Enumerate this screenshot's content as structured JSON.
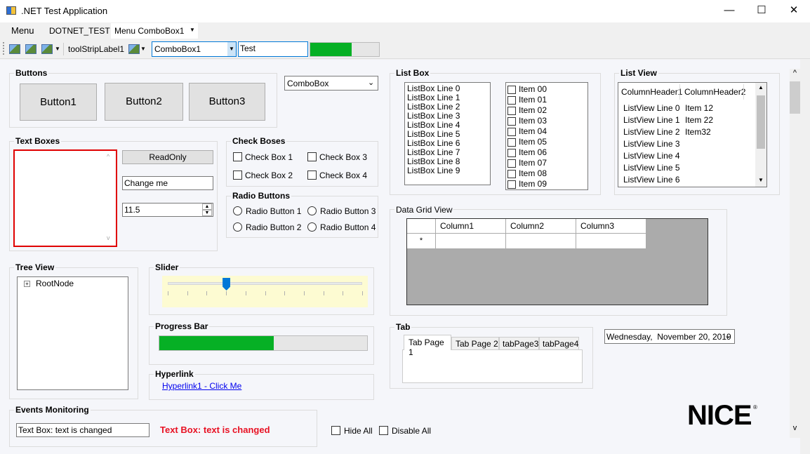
{
  "window": {
    "title": ".NET Test Application",
    "minimize": "—",
    "maximize": "☐",
    "close": "✕"
  },
  "menu": {
    "items": [
      "Menu",
      "DOTNET_TEST",
      "Menu ComboBox1"
    ]
  },
  "toolbar": {
    "label": "toolStripLabel1",
    "combo": "ComboBox1",
    "text": "Test",
    "progress_pct": 60
  },
  "buttons": {
    "title": "Buttons",
    "b1": "Button1",
    "b2": "Button2",
    "b3": "Button3"
  },
  "combo": {
    "value": "ComboBox"
  },
  "textboxes": {
    "title": "Text Boxes",
    "readonly": "ReadOnly",
    "changeme": "Change me",
    "numeric": "11.5"
  },
  "checkboxes": {
    "title": "Check Boses",
    "c1": "Check Box 1",
    "c2": "Check Box 2",
    "c3": "Check Box 3",
    "c4": "Check Box 4"
  },
  "radios": {
    "title": "Radio Buttons",
    "r1": "Radio Button 1",
    "r2": "Radio Button 2",
    "r3": "Radio Button 3",
    "r4": "Radio Button 4"
  },
  "listbox": {
    "title": "List Box",
    "lines": [
      "ListBox Line 0",
      "ListBox Line 1",
      "ListBox Line 2",
      "ListBox Line 3",
      "ListBox Line 4",
      "ListBox Line 5",
      "ListBox Line 6",
      "ListBox Line 7",
      "ListBox Line 8",
      "ListBox Line 9"
    ],
    "items": [
      "Item 00",
      "Item 01",
      "Item 02",
      "Item 03",
      "Item 04",
      "Item 05",
      "Item 06",
      "Item 07",
      "Item 08",
      "Item 09"
    ]
  },
  "listview": {
    "title": "List View",
    "headers": [
      "ColumnHeader1",
      "ColumnHeader2"
    ],
    "rows": [
      [
        "ListView Line 0",
        "Item 12"
      ],
      [
        "ListView Line 1",
        "Item 22"
      ],
      [
        "ListView Line 2",
        "Item32"
      ],
      [
        "ListView Line 3",
        ""
      ],
      [
        "ListView Line 4",
        ""
      ],
      [
        "ListView Line 5",
        ""
      ],
      [
        "ListView Line 6",
        ""
      ]
    ]
  },
  "treeview": {
    "title": "Tree View",
    "root": "RootNode"
  },
  "slider": {
    "title": "Slider",
    "value_pct": 30
  },
  "progress": {
    "title": "Progress Bar",
    "value_pct": 55
  },
  "hyperlink": {
    "title": "Hyperlink",
    "text": "Hyperlink1 - Click Me"
  },
  "grid": {
    "title": "Data Grid View",
    "columns": [
      "Column1",
      "Column2",
      "Column3"
    ],
    "new_row": "*"
  },
  "tab": {
    "title": "Tab",
    "tabs": [
      "Tab Page 1",
      "Tab Page 2",
      "tabPage3",
      "tabPage4"
    ]
  },
  "date": {
    "value": "Wednesday,  November 20, 2019"
  },
  "events": {
    "title": "Events Monitoring",
    "textbox": "Text Box: text is changed",
    "message": "Text Box: text is changed"
  },
  "options": {
    "hide_all": "Hide All",
    "disable_all": "Disable All"
  },
  "logo": {
    "text": "NICE"
  },
  "colors": {
    "accent": "#06b025",
    "error": "#e81123"
  }
}
